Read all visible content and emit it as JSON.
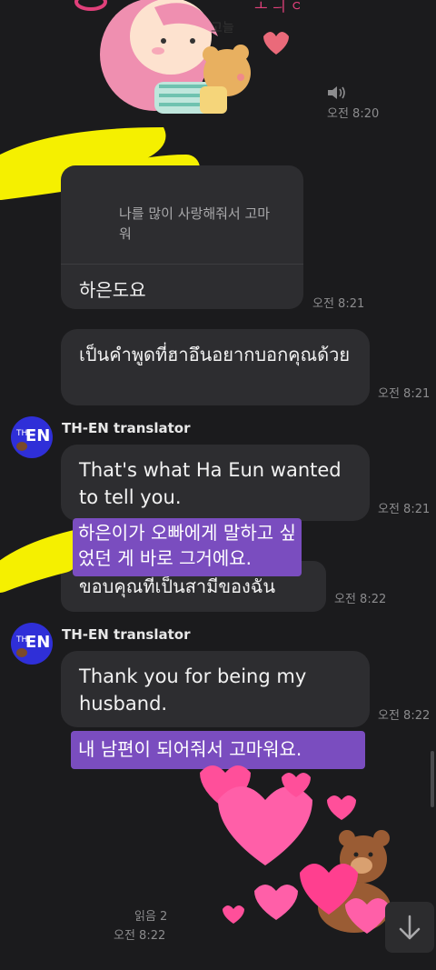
{
  "sticker_top": {
    "label": "고늘"
  },
  "messages": [
    {
      "time": "오전 8:20"
    },
    {
      "quote": "나를 많이 사랑해줘서 고마워",
      "text": "하은도요",
      "time": "오전 8:21"
    },
    {
      "text": "เป็นคำพูดที่ฮาอึนอยากบอกคุณด้วย",
      "time": "오전 8:21"
    },
    {
      "sender": "TH-EN translator",
      "text": "That's what Ha Eun wanted to tell you.",
      "time": "오전 8:21"
    },
    {
      "overlay": "하은이가 오빠에게 말하고 싶었던 게 바로 그거에요.",
      "text": "ขอบคุณที่เป็นสามีของฉัน",
      "time": "오전 8:22"
    },
    {
      "sender": "TH-EN translator",
      "text": "Thank you for being my husband.",
      "time": "오전 8:22"
    },
    {
      "overlay": "내 남편이 되어줘서 고마워요."
    },
    {
      "read": "읽음 2",
      "time": "오전 8:22"
    }
  ],
  "avatar": {
    "th": "TH",
    "en": "EN"
  },
  "icons": [
    "speaker-icon",
    "scroll-down-icon"
  ]
}
